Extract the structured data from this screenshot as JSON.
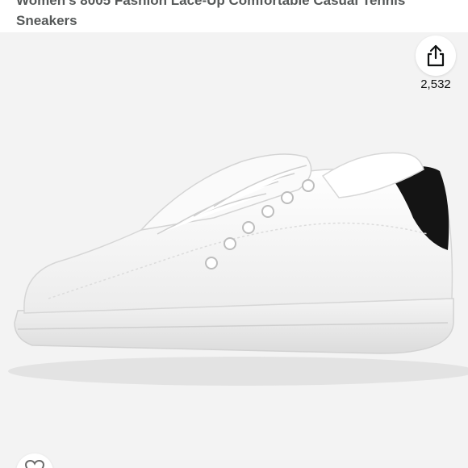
{
  "product": {
    "title_line1": "Women's 8005 Fashion Lace-Up Comfortable Casual Tennis",
    "title_line2": "Sneakers"
  },
  "share": {
    "icon": "share-icon",
    "count": "2,532"
  },
  "wishlist": {
    "icon": "heart-icon"
  },
  "colors": {
    "image_background": "#f3f3f3",
    "shoe_body": "#ffffff",
    "heel_tab": "#141414",
    "title_text": "#565959"
  }
}
